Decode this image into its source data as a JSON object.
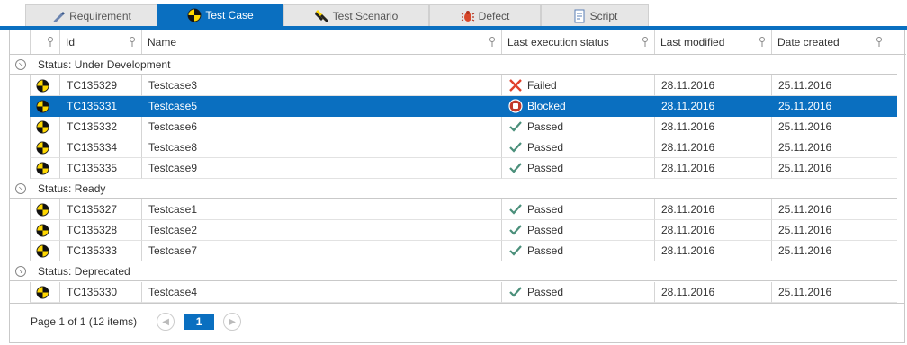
{
  "tabs": [
    {
      "label": "Requirement",
      "icon": "requirement-icon"
    },
    {
      "label": "Test Case",
      "icon": "test-case-icon",
      "active": true
    },
    {
      "label": "Test Scenario",
      "icon": "test-scenario-icon"
    },
    {
      "label": "Defect",
      "icon": "bug-icon"
    },
    {
      "label": "Script",
      "icon": "script-icon"
    }
  ],
  "columns": {
    "id": "Id",
    "name": "Name",
    "status": "Last execution status",
    "modified": "Last modified",
    "created": "Date created"
  },
  "groups": [
    {
      "label": "Status: Under Development",
      "rows": [
        {
          "id": "TC135329",
          "name": "Testcase3",
          "status": "Failed",
          "modified": "28.11.2016",
          "created": "25.11.2016"
        },
        {
          "id": "TC135331",
          "name": "Testcase5",
          "status": "Blocked",
          "modified": "28.11.2016",
          "created": "25.11.2016",
          "selected": true
        },
        {
          "id": "TC135332",
          "name": "Testcase6",
          "status": "Passed",
          "modified": "28.11.2016",
          "created": "25.11.2016"
        },
        {
          "id": "TC135334",
          "name": "Testcase8",
          "status": "Passed",
          "modified": "28.11.2016",
          "created": "25.11.2016"
        },
        {
          "id": "TC135335",
          "name": "Testcase9",
          "status": "Passed",
          "modified": "28.11.2016",
          "created": "25.11.2016"
        }
      ]
    },
    {
      "label": "Status: Ready",
      "rows": [
        {
          "id": "TC135327",
          "name": "Testcase1",
          "status": "Passed",
          "modified": "28.11.2016",
          "created": "25.11.2016"
        },
        {
          "id": "TC135328",
          "name": "Testcase2",
          "status": "Passed",
          "modified": "28.11.2016",
          "created": "25.11.2016"
        },
        {
          "id": "TC135333",
          "name": "Testcase7",
          "status": "Passed",
          "modified": "28.11.2016",
          "created": "25.11.2016"
        }
      ]
    },
    {
      "label": "Status: Deprecated",
      "rows": [
        {
          "id": "TC135330",
          "name": "Testcase4",
          "status": "Passed",
          "modified": "28.11.2016",
          "created": "25.11.2016"
        }
      ]
    }
  ],
  "pager": {
    "info": "Page 1 of 1 (12 items)",
    "current": "1"
  },
  "colors": {
    "accent": "#0a6fc0",
    "failed": "#e0402a",
    "passed": "#4a8f7a",
    "blocked": "#c0392b"
  }
}
